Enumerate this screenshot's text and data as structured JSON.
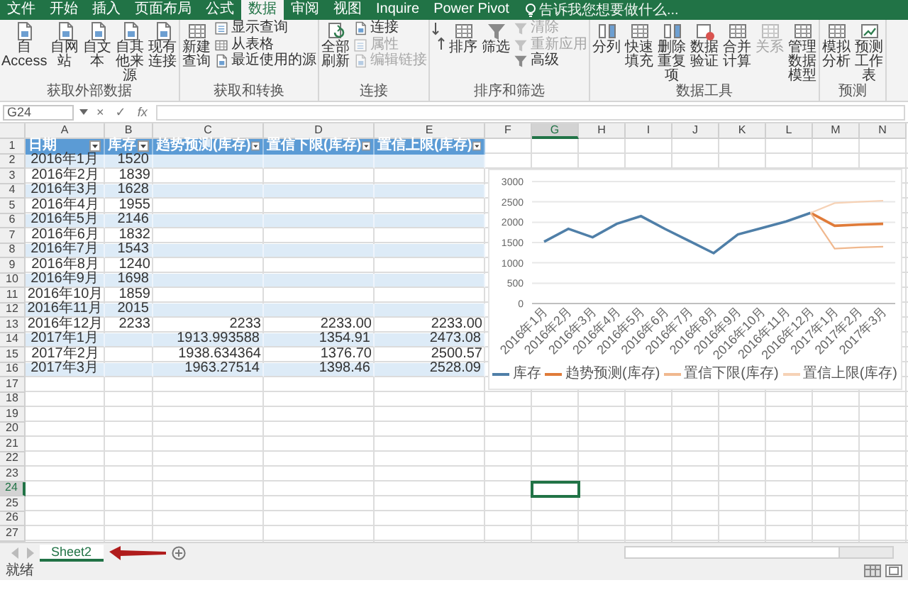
{
  "ribbon": {
    "tabs": [
      {
        "label": "文件",
        "selected": false
      },
      {
        "label": "开始",
        "selected": false
      },
      {
        "label": "插入",
        "selected": false
      },
      {
        "label": "页面布局",
        "selected": false
      },
      {
        "label": "公式",
        "selected": false
      },
      {
        "label": "数据",
        "selected": true
      },
      {
        "label": "审阅",
        "selected": false
      },
      {
        "label": "视图",
        "selected": false
      },
      {
        "label": "Inquire",
        "selected": false
      },
      {
        "label": "Power Pivot",
        "selected": false
      }
    ],
    "search": {
      "placeholder": "告诉我您想要做什么..."
    },
    "groups": [
      {
        "label": "获取外部数据",
        "buttons": [
          {
            "kind": "large",
            "label": "自 Access",
            "disabled": false
          },
          {
            "kind": "large",
            "label": "自网站",
            "disabled": false
          },
          {
            "kind": "large",
            "label": "自文本",
            "disabled": false
          },
          {
            "kind": "large",
            "label": "自其他来源",
            "disabled": false
          },
          {
            "kind": "large",
            "label": "现有连接",
            "disabled": false
          }
        ]
      },
      {
        "label": "获取和转换",
        "buttons": [
          {
            "kind": "large",
            "label": "新建查询",
            "disabled": false
          },
          {
            "kind": "small",
            "label": "显示查询",
            "disabled": false
          },
          {
            "kind": "small",
            "label": "从表格",
            "disabled": false
          },
          {
            "kind": "small",
            "label": "最近使用的源",
            "disabled": false
          }
        ]
      },
      {
        "label": "连接",
        "buttons": [
          {
            "kind": "large",
            "label": "全部刷新",
            "disabled": false
          },
          {
            "kind": "small",
            "label": "连接",
            "disabled": false
          },
          {
            "kind": "small",
            "label": "属性",
            "disabled": true
          },
          {
            "kind": "small",
            "label": "编辑链接",
            "disabled": true
          }
        ]
      },
      {
        "label": "排序和筛选",
        "buttons": [
          {
            "kind": "icon",
            "disabled": false
          },
          {
            "kind": "large",
            "label": "排序",
            "disabled": false
          },
          {
            "kind": "large",
            "label": "筛选",
            "disabled": false
          },
          {
            "kind": "small",
            "label": "清除",
            "disabled": true
          },
          {
            "kind": "small",
            "label": "重新应用",
            "disabled": true
          },
          {
            "kind": "small",
            "label": "高级",
            "disabled": false
          }
        ]
      },
      {
        "label": "数据工具",
        "buttons": [
          {
            "kind": "large",
            "label": "分列",
            "disabled": false
          },
          {
            "kind": "large",
            "label": "快速填充",
            "disabled": false
          },
          {
            "kind": "large",
            "label": "删除重复项",
            "disabled": false
          },
          {
            "kind": "large",
            "label": "数据验证",
            "disabled": false
          },
          {
            "kind": "large",
            "label": "合并计算",
            "disabled": false
          },
          {
            "kind": "large",
            "label": "关系",
            "disabled": true
          },
          {
            "kind": "large",
            "label": "管理数据模型",
            "disabled": false
          }
        ]
      },
      {
        "label": "预测",
        "buttons": [
          {
            "kind": "large",
            "label": "模拟分析",
            "disabled": false
          },
          {
            "kind": "large",
            "label": "预测工作表",
            "disabled": false
          }
        ]
      }
    ]
  },
  "formula_bar": {
    "name_box": "G24",
    "buttons": [
      "×",
      "✓",
      "fx"
    ]
  },
  "sheet": {
    "columns": [
      {
        "label": "A",
        "selected": false
      },
      {
        "label": "B",
        "selected": false
      },
      {
        "label": "C",
        "selected": false
      },
      {
        "label": "D",
        "selected": false
      },
      {
        "label": "E",
        "selected": false
      },
      {
        "label": "F",
        "selected": false
      },
      {
        "label": "G",
        "selected": true
      },
      {
        "label": "H",
        "selected": false
      },
      {
        "label": "I",
        "selected": false
      },
      {
        "label": "J",
        "selected": false
      },
      {
        "label": "K",
        "selected": false
      },
      {
        "label": "L",
        "selected": false
      },
      {
        "label": "M",
        "selected": false
      },
      {
        "label": "N",
        "selected": false
      }
    ],
    "rows": [
      {
        "label": "1",
        "selected": false
      },
      {
        "label": "2",
        "selected": false
      },
      {
        "label": "3",
        "selected": false
      },
      {
        "label": "4",
        "selected": false
      },
      {
        "label": "5",
        "selected": false
      },
      {
        "label": "6",
        "selected": false
      },
      {
        "label": "7",
        "selected": false
      },
      {
        "label": "8",
        "selected": false
      },
      {
        "label": "9",
        "selected": false
      },
      {
        "label": "10",
        "selected": false
      },
      {
        "label": "11",
        "selected": false
      },
      {
        "label": "12",
        "selected": false
      },
      {
        "label": "13",
        "selected": false
      },
      {
        "label": "14",
        "selected": false
      },
      {
        "label": "15",
        "selected": false
      },
      {
        "label": "16",
        "selected": false
      },
      {
        "label": "17",
        "selected": false
      },
      {
        "label": "18",
        "selected": false
      },
      {
        "label": "19",
        "selected": false
      },
      {
        "label": "20",
        "selected": false
      },
      {
        "label": "21",
        "selected": false
      },
      {
        "label": "22",
        "selected": false
      },
      {
        "label": "23",
        "selected": false
      },
      {
        "label": "24",
        "selected": true
      },
      {
        "label": "25",
        "selected": false
      },
      {
        "label": "26",
        "selected": false
      },
      {
        "label": "27",
        "selected": false
      }
    ]
  },
  "table": {
    "columns": [
      "日期",
      "库存",
      "趋势预测(库存)",
      "置信下限(库存)",
      "置信上限(库存)"
    ],
    "rows": [
      {
        "date": "2016年1月",
        "stock": "1520"
      },
      {
        "date": "2016年2月",
        "stock": "1839"
      },
      {
        "date": "2016年3月",
        "stock": "1628"
      },
      {
        "date": "2016年4月",
        "stock": "1955"
      },
      {
        "date": "2016年5月",
        "stock": "2146"
      },
      {
        "date": "2016年6月",
        "stock": "1832"
      },
      {
        "date": "2016年7月",
        "stock": "1543"
      },
      {
        "date": "2016年8月",
        "stock": "1240"
      },
      {
        "date": "2016年9月",
        "stock": "1698"
      },
      {
        "date": "2016年10月",
        "stock": "1859"
      },
      {
        "date": "2016年11月",
        "stock": "2015"
      },
      {
        "date": "2016年12月",
        "stock": "2233",
        "forecast": "2233",
        "lower": "2233.00",
        "upper": "2233.00"
      },
      {
        "date": "2017年1月",
        "forecast": "1913.993588",
        "lower": "1354.91",
        "upper": "2473.08"
      },
      {
        "date": "2017年2月",
        "forecast": "1938.634364",
        "lower": "1376.70",
        "upper": "2500.57"
      },
      {
        "date": "2017年3月",
        "forecast": "1963.27514",
        "lower": "1398.46",
        "upper": "2528.09"
      }
    ]
  },
  "chart": {
    "chart_data": {
      "type": "line",
      "grid": true,
      "legend": true,
      "categories": [
        "2016年1月",
        "2016年2月",
        "2016年3月",
        "2016年4月",
        "2016年5月",
        "2016年6月",
        "2016年7月",
        "2016年8月",
        "2016年9月",
        "2016年10月",
        "2016年11月",
        "2016年12月",
        "2017年1月",
        "2017年2月",
        "2017年3月"
      ],
      "ylim": [
        0,
        3000
      ],
      "yticks": [
        0,
        500,
        1000,
        1500,
        2000,
        2500,
        3000
      ],
      "series": [
        {
          "name": "库存",
          "color": "#4f7fa8",
          "values": [
            1520,
            1840,
            1630,
            1960,
            2150,
            1830,
            1540,
            1240,
            1700,
            1860,
            2020,
            2230,
            null,
            null,
            null
          ]
        },
        {
          "name": "趋势预测(库存)",
          "color": "#e07b39",
          "values": [
            null,
            null,
            null,
            null,
            null,
            null,
            null,
            null,
            null,
            null,
            null,
            2230,
            1910,
            1940,
            1960
          ]
        },
        {
          "name": "置信下限(库存)",
          "color": "#f0b88e",
          "values": [
            null,
            null,
            null,
            null,
            null,
            null,
            null,
            null,
            null,
            null,
            null,
            2230,
            1350,
            1380,
            1400
          ]
        },
        {
          "name": "置信上限(库存)",
          "color": "#f6d2b6",
          "values": [
            null,
            null,
            null,
            null,
            null,
            null,
            null,
            null,
            null,
            null,
            null,
            2230,
            2470,
            2500,
            2530
          ]
        }
      ]
    }
  },
  "sheet_tabs": [
    {
      "label": "Sheet2",
      "selected": true
    }
  ],
  "status_bar": {
    "text": "就绪"
  }
}
